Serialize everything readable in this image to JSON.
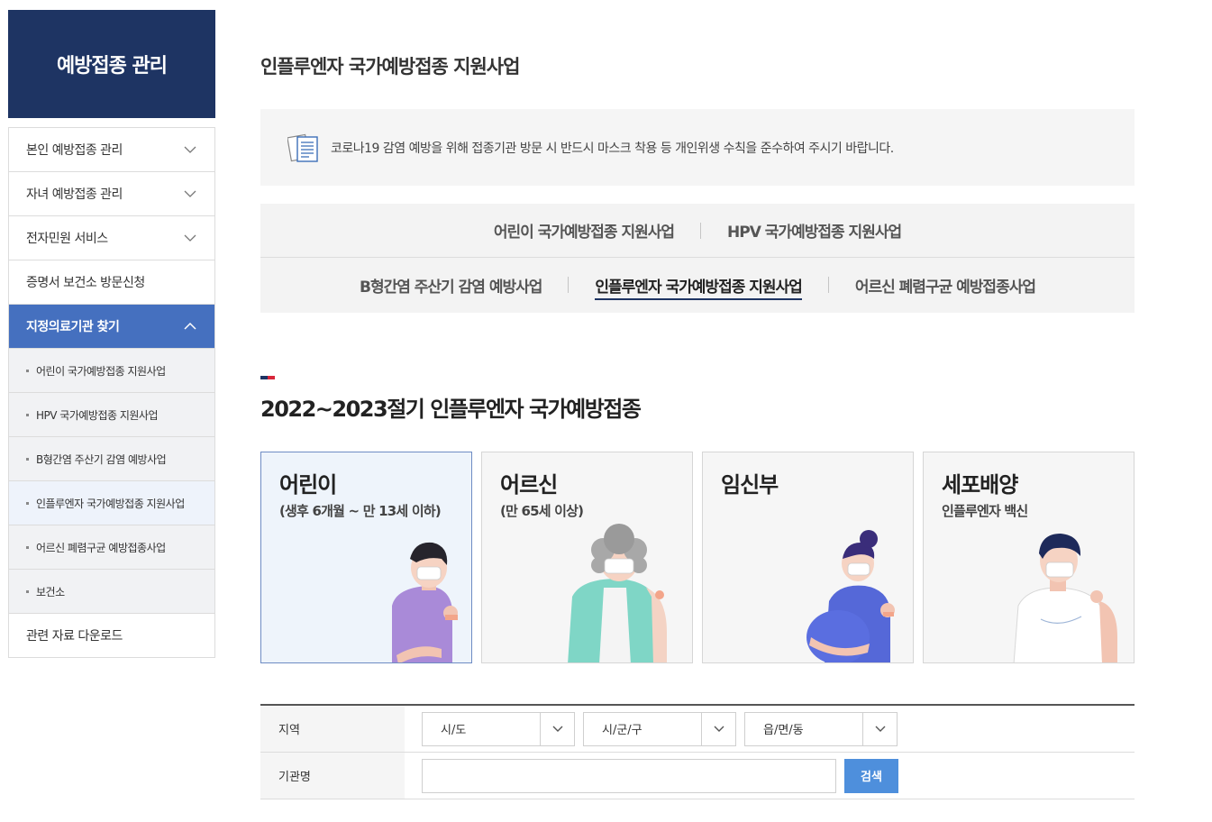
{
  "sidebar": {
    "title": "예방접종 관리",
    "items": [
      {
        "label": "본인 예방접종 관리"
      },
      {
        "label": "자녀 예방접종 관리"
      },
      {
        "label": "전자민원 서비스"
      },
      {
        "label": "증명서 보건소 방문신청"
      },
      {
        "label": "지정의료기관 찾기"
      }
    ],
    "subitems": [
      {
        "label": "어린이 국가예방접종 지원사업"
      },
      {
        "label": "HPV 국가예방접종 지원사업"
      },
      {
        "label": "B형간염 주산기 감염 예방사업"
      },
      {
        "label": "인플루엔자 국가예방접종 지원사업"
      },
      {
        "label": "어르신 폐렴구균 예방접종사업"
      },
      {
        "label": "보건소"
      }
    ],
    "last_item": {
      "label": "관련 자료 다운로드"
    }
  },
  "page_title": "인플루엔자 국가예방접종 지원사업",
  "notice": {
    "text": "코로나19 감염 예방을 위해 접종기관 방문 시 반드시 마스크 착용 등 개인위생 수칙을 준수하여 주시기 바랍니다."
  },
  "tabs": {
    "row1": [
      {
        "label": "어린이 국가예방접종 지원사업"
      },
      {
        "label": "HPV 국가예방접종 지원사업"
      }
    ],
    "row2": [
      {
        "label": "B형간염 주산기 감염 예방사업"
      },
      {
        "label": "인플루엔자 국가예방접종 지원사업"
      },
      {
        "label": "어르신 폐렴구균 예방접종사업"
      }
    ]
  },
  "section_title": "2022~2023절기 인플루엔자 국가예방접종",
  "cards": [
    {
      "title": "어린이",
      "subtitle": "(생후 6개월 ~ 만 13세 이하)"
    },
    {
      "title": "어르신",
      "subtitle": "(만 65세 이상)"
    },
    {
      "title": "임신부",
      "subtitle": ""
    },
    {
      "title": "세포배양",
      "subtitle": "인플루엔자 백신"
    }
  ],
  "search": {
    "region_label": "지역",
    "sido": "시/도",
    "sigungu": "시/군/구",
    "eupmyeondong": "읍/면/동",
    "name_label": "기관명",
    "name_value": "",
    "button": "검색"
  },
  "colors": {
    "navy": "#1e3463",
    "active_blue": "#4570bf",
    "button_blue": "#4e8fdc"
  }
}
